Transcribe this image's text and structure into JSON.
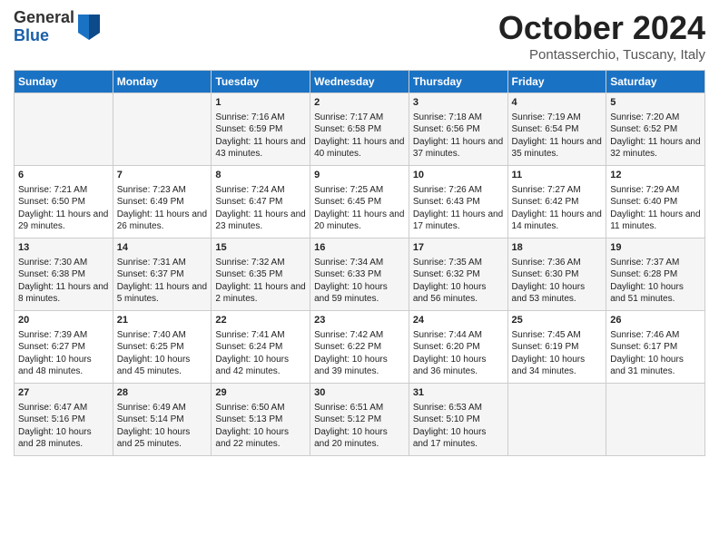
{
  "header": {
    "logo_general": "General",
    "logo_blue": "Blue",
    "month_title": "October 2024",
    "location": "Pontasserchio, Tuscany, Italy"
  },
  "days_of_week": [
    "Sunday",
    "Monday",
    "Tuesday",
    "Wednesday",
    "Thursday",
    "Friday",
    "Saturday"
  ],
  "weeks": [
    [
      {
        "day": "",
        "content": ""
      },
      {
        "day": "",
        "content": ""
      },
      {
        "day": "1",
        "content": "Sunrise: 7:16 AM\nSunset: 6:59 PM\nDaylight: 11 hours and 43 minutes."
      },
      {
        "day": "2",
        "content": "Sunrise: 7:17 AM\nSunset: 6:58 PM\nDaylight: 11 hours and 40 minutes."
      },
      {
        "day": "3",
        "content": "Sunrise: 7:18 AM\nSunset: 6:56 PM\nDaylight: 11 hours and 37 minutes."
      },
      {
        "day": "4",
        "content": "Sunrise: 7:19 AM\nSunset: 6:54 PM\nDaylight: 11 hours and 35 minutes."
      },
      {
        "day": "5",
        "content": "Sunrise: 7:20 AM\nSunset: 6:52 PM\nDaylight: 11 hours and 32 minutes."
      }
    ],
    [
      {
        "day": "6",
        "content": "Sunrise: 7:21 AM\nSunset: 6:50 PM\nDaylight: 11 hours and 29 minutes."
      },
      {
        "day": "7",
        "content": "Sunrise: 7:23 AM\nSunset: 6:49 PM\nDaylight: 11 hours and 26 minutes."
      },
      {
        "day": "8",
        "content": "Sunrise: 7:24 AM\nSunset: 6:47 PM\nDaylight: 11 hours and 23 minutes."
      },
      {
        "day": "9",
        "content": "Sunrise: 7:25 AM\nSunset: 6:45 PM\nDaylight: 11 hours and 20 minutes."
      },
      {
        "day": "10",
        "content": "Sunrise: 7:26 AM\nSunset: 6:43 PM\nDaylight: 11 hours and 17 minutes."
      },
      {
        "day": "11",
        "content": "Sunrise: 7:27 AM\nSunset: 6:42 PM\nDaylight: 11 hours and 14 minutes."
      },
      {
        "day": "12",
        "content": "Sunrise: 7:29 AM\nSunset: 6:40 PM\nDaylight: 11 hours and 11 minutes."
      }
    ],
    [
      {
        "day": "13",
        "content": "Sunrise: 7:30 AM\nSunset: 6:38 PM\nDaylight: 11 hours and 8 minutes."
      },
      {
        "day": "14",
        "content": "Sunrise: 7:31 AM\nSunset: 6:37 PM\nDaylight: 11 hours and 5 minutes."
      },
      {
        "day": "15",
        "content": "Sunrise: 7:32 AM\nSunset: 6:35 PM\nDaylight: 11 hours and 2 minutes."
      },
      {
        "day": "16",
        "content": "Sunrise: 7:34 AM\nSunset: 6:33 PM\nDaylight: 10 hours and 59 minutes."
      },
      {
        "day": "17",
        "content": "Sunrise: 7:35 AM\nSunset: 6:32 PM\nDaylight: 10 hours and 56 minutes."
      },
      {
        "day": "18",
        "content": "Sunrise: 7:36 AM\nSunset: 6:30 PM\nDaylight: 10 hours and 53 minutes."
      },
      {
        "day": "19",
        "content": "Sunrise: 7:37 AM\nSunset: 6:28 PM\nDaylight: 10 hours and 51 minutes."
      }
    ],
    [
      {
        "day": "20",
        "content": "Sunrise: 7:39 AM\nSunset: 6:27 PM\nDaylight: 10 hours and 48 minutes."
      },
      {
        "day": "21",
        "content": "Sunrise: 7:40 AM\nSunset: 6:25 PM\nDaylight: 10 hours and 45 minutes."
      },
      {
        "day": "22",
        "content": "Sunrise: 7:41 AM\nSunset: 6:24 PM\nDaylight: 10 hours and 42 minutes."
      },
      {
        "day": "23",
        "content": "Sunrise: 7:42 AM\nSunset: 6:22 PM\nDaylight: 10 hours and 39 minutes."
      },
      {
        "day": "24",
        "content": "Sunrise: 7:44 AM\nSunset: 6:20 PM\nDaylight: 10 hours and 36 minutes."
      },
      {
        "day": "25",
        "content": "Sunrise: 7:45 AM\nSunset: 6:19 PM\nDaylight: 10 hours and 34 minutes."
      },
      {
        "day": "26",
        "content": "Sunrise: 7:46 AM\nSunset: 6:17 PM\nDaylight: 10 hours and 31 minutes."
      }
    ],
    [
      {
        "day": "27",
        "content": "Sunrise: 6:47 AM\nSunset: 5:16 PM\nDaylight: 10 hours and 28 minutes."
      },
      {
        "day": "28",
        "content": "Sunrise: 6:49 AM\nSunset: 5:14 PM\nDaylight: 10 hours and 25 minutes."
      },
      {
        "day": "29",
        "content": "Sunrise: 6:50 AM\nSunset: 5:13 PM\nDaylight: 10 hours and 22 minutes."
      },
      {
        "day": "30",
        "content": "Sunrise: 6:51 AM\nSunset: 5:12 PM\nDaylight: 10 hours and 20 minutes."
      },
      {
        "day": "31",
        "content": "Sunrise: 6:53 AM\nSunset: 5:10 PM\nDaylight: 10 hours and 17 minutes."
      },
      {
        "day": "",
        "content": ""
      },
      {
        "day": "",
        "content": ""
      }
    ]
  ]
}
